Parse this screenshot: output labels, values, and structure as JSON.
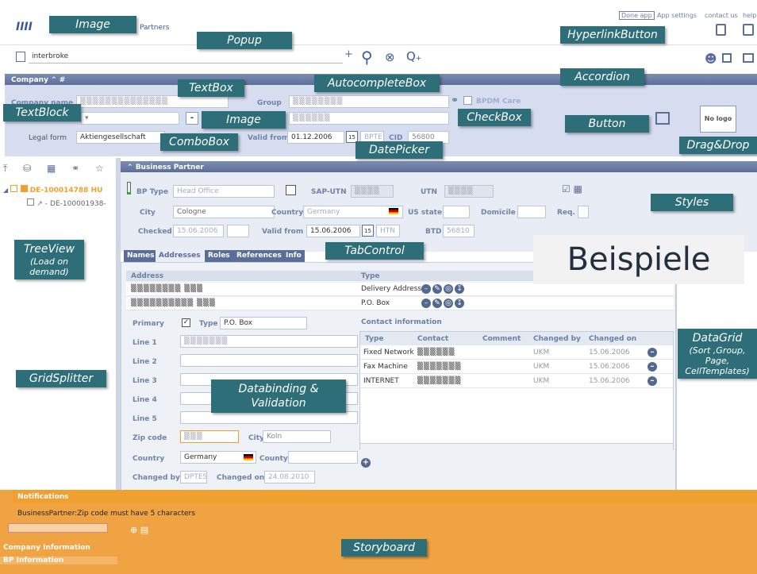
{
  "header": {
    "logo_text": "Partners",
    "top_links": [
      "Done app",
      "App settings",
      "contact us",
      "help"
    ]
  },
  "search": {
    "value": "interbroke"
  },
  "company": {
    "title": "Company",
    "name_label": "Company name",
    "group_label": "Group",
    "bpdm_label": "BPDM Care",
    "legal_form_label": "Legal form",
    "legal_form_value": "Aktiengesellschaft",
    "valid_from_label": "Valid from",
    "valid_from_value": "01.12.2006",
    "bpte_label": "BPTE",
    "cid_label": "CID",
    "cid_value": "56800",
    "no_logo": "No logo"
  },
  "tree": {
    "node1": "DE-100014788 HU",
    "node2": "DE-100001938-",
    "nav_company": "Company Information",
    "nav_bp": "BP Information"
  },
  "bp": {
    "title": "Business Partner",
    "type_label": "BP Type",
    "type_value": "Head Office",
    "sap_label": "SAP-UTN",
    "utn_label": "UTN",
    "city_label": "City",
    "city_value": "Cologne",
    "country_label": "Country",
    "country_value": "Germany",
    "us_state_label": "US state",
    "domicile_label": "Domicile",
    "req_label": "Req.",
    "checked_label": "Checked",
    "checked_value": "15.06.2006",
    "valid_from_label": "Valid from",
    "valid_from_value": "15.06.2006",
    "htn_label": "HTN",
    "btd_label": "BTD",
    "btd_value": "56810"
  },
  "tabs": [
    "Names",
    "Addresses",
    "Roles",
    "References",
    "Info"
  ],
  "addresses": {
    "col_address": "Address",
    "col_type": "Type",
    "rows": [
      {
        "type": "Delivery Address"
      },
      {
        "type": "P.O. Box"
      }
    ]
  },
  "form": {
    "primary_label": "Primary",
    "type_label": "Type",
    "type_value": "P.O. Box",
    "line1": "Line 1",
    "line2": "Line 2",
    "line3": "Line 3",
    "line4": "Line 4",
    "line5": "Line 5",
    "zip_label": "Zip code",
    "city_label": "City",
    "city_value": "Koln",
    "country_label": "Country",
    "country_value": "Germany",
    "county_label": "County",
    "changed_by_label": "Changed by",
    "changed_by_value": "DPTEST",
    "changed_on_label": "Changed on",
    "changed_on_value": "24.08.2010"
  },
  "contacts": {
    "title": "Contact information",
    "headers": [
      "Type",
      "Contact",
      "Comment",
      "Changed by",
      "Changed on"
    ],
    "rows": [
      {
        "type": "Fixed Network",
        "changed_by": "UKM",
        "changed_on": "15.06.2006"
      },
      {
        "type": "Fax Machine",
        "changed_by": "UKM",
        "changed_on": "15.06.2006"
      },
      {
        "type": "INTERNET",
        "changed_by": "UKM",
        "changed_on": "15.06.2006"
      }
    ]
  },
  "notifications": {
    "title": "Notifications",
    "message": "BusinessPartner:Zip code must have 5 characters"
  },
  "banner": "Beispiele",
  "labels": {
    "image": "Image",
    "popup": "Popup",
    "hyperlink": "HyperlinkButton",
    "textbox": "TextBox",
    "autocomplete": "AutocompleteBox",
    "accordion": "Accordion",
    "textblock": "TextBlock",
    "image2": "Image",
    "checkbox": "CheckBox",
    "button": "Button",
    "combobox": "ComboBox",
    "datepicker": "DatePicker",
    "dragdrop": "Drag&Drop",
    "styles": "Styles",
    "treeview": "TreeView",
    "treeview_sub": "(Load on demand)",
    "tabcontrol": "TabControl",
    "datagrid": "DataGrid",
    "datagrid_sub": "(Sort ,Group, Page, CellTemplates)",
    "gridsplitter": "GridSplitter",
    "databinding": "Databinding & Validation",
    "storyboard": "Storyboard"
  }
}
